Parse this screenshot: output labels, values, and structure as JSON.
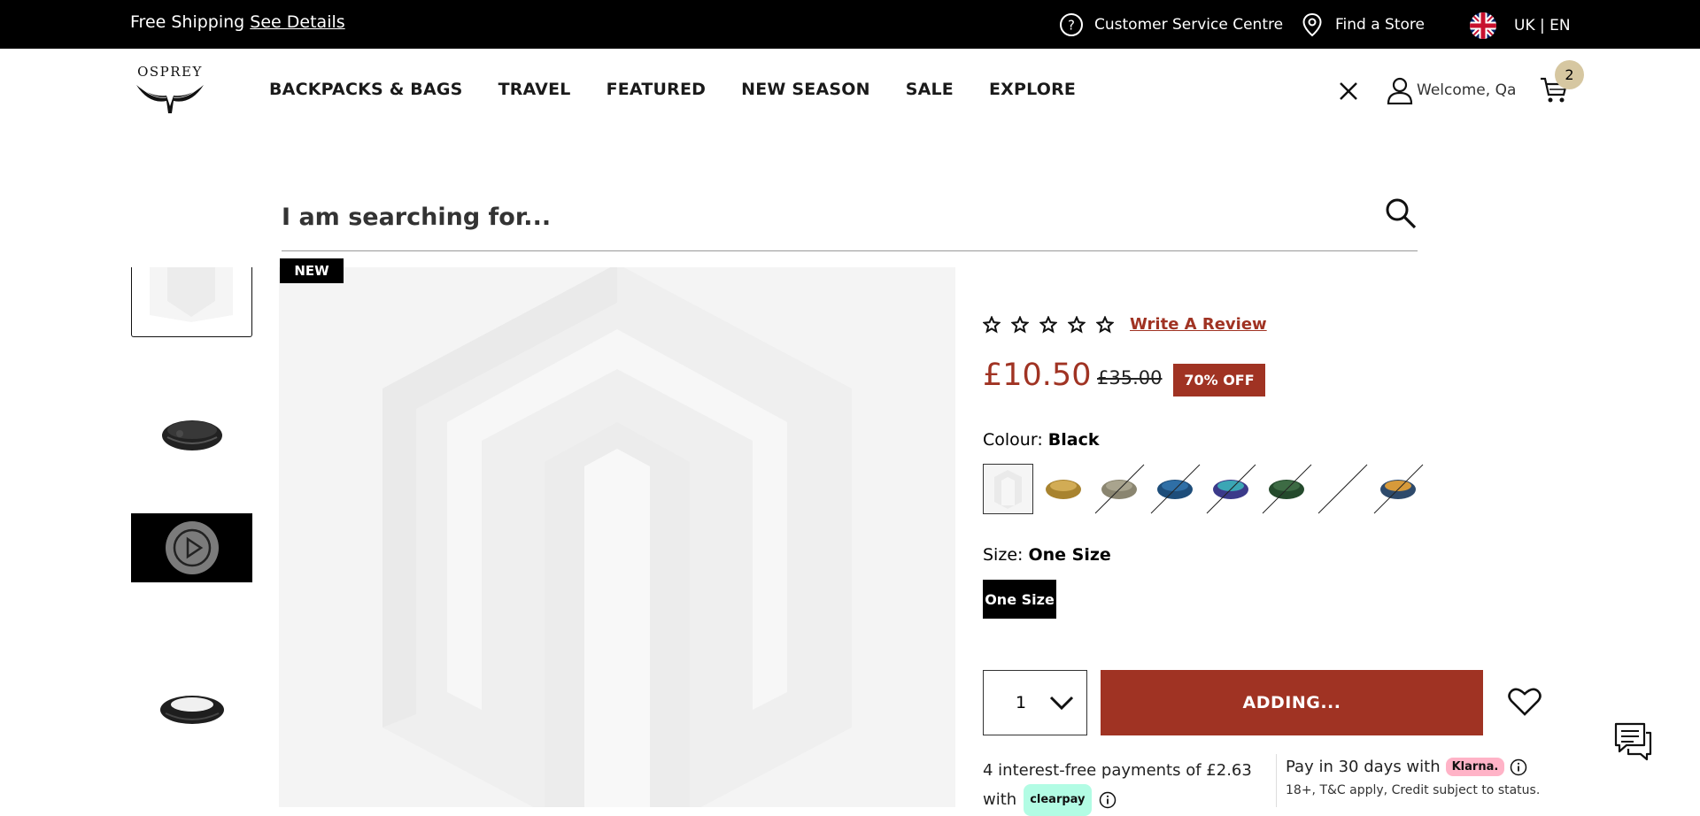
{
  "topbar": {
    "shipping_text": "Free Shipping",
    "shipping_link": "See Details",
    "customer_service": "Customer Service Centre",
    "find_store": "Find a Store",
    "locale": "UK | EN"
  },
  "header": {
    "logo_text": "OSPREY",
    "nav": [
      "BACKPACKS & BAGS",
      "TRAVEL",
      "FEATURED",
      "NEW SEASON",
      "SALE",
      "EXPLORE"
    ],
    "welcome": "Welcome, Qa",
    "cart_count": "2"
  },
  "search": {
    "placeholder": "I am searching for..."
  },
  "gallery": {
    "badge": "NEW"
  },
  "product": {
    "review_link": "Write A Review",
    "price": "£10.50",
    "old_price": "£35.00",
    "discount": "70% OFF",
    "colour_label": "Colour:",
    "colour_value": "Black",
    "size_label": "Size:",
    "size_value": "One Size",
    "size_option": "One Size",
    "quantity": "1",
    "add_button": "ADDING..."
  },
  "payments": {
    "clearpay_text": "4 interest-free payments of £2.63",
    "clearpay_with": "with",
    "clearpay_logo": "clearpay",
    "klarna_text": "Pay in 30 days with",
    "klarna_logo": "Klarna.",
    "klarna_terms": "18+, T&C apply, Credit subject to status."
  },
  "colors": {
    "accent": "#a03323",
    "topbar": "#000000",
    "cart_badge": "#d6c7a1",
    "clearpay": "#b2fce4",
    "klarna": "#ffb3c7"
  }
}
